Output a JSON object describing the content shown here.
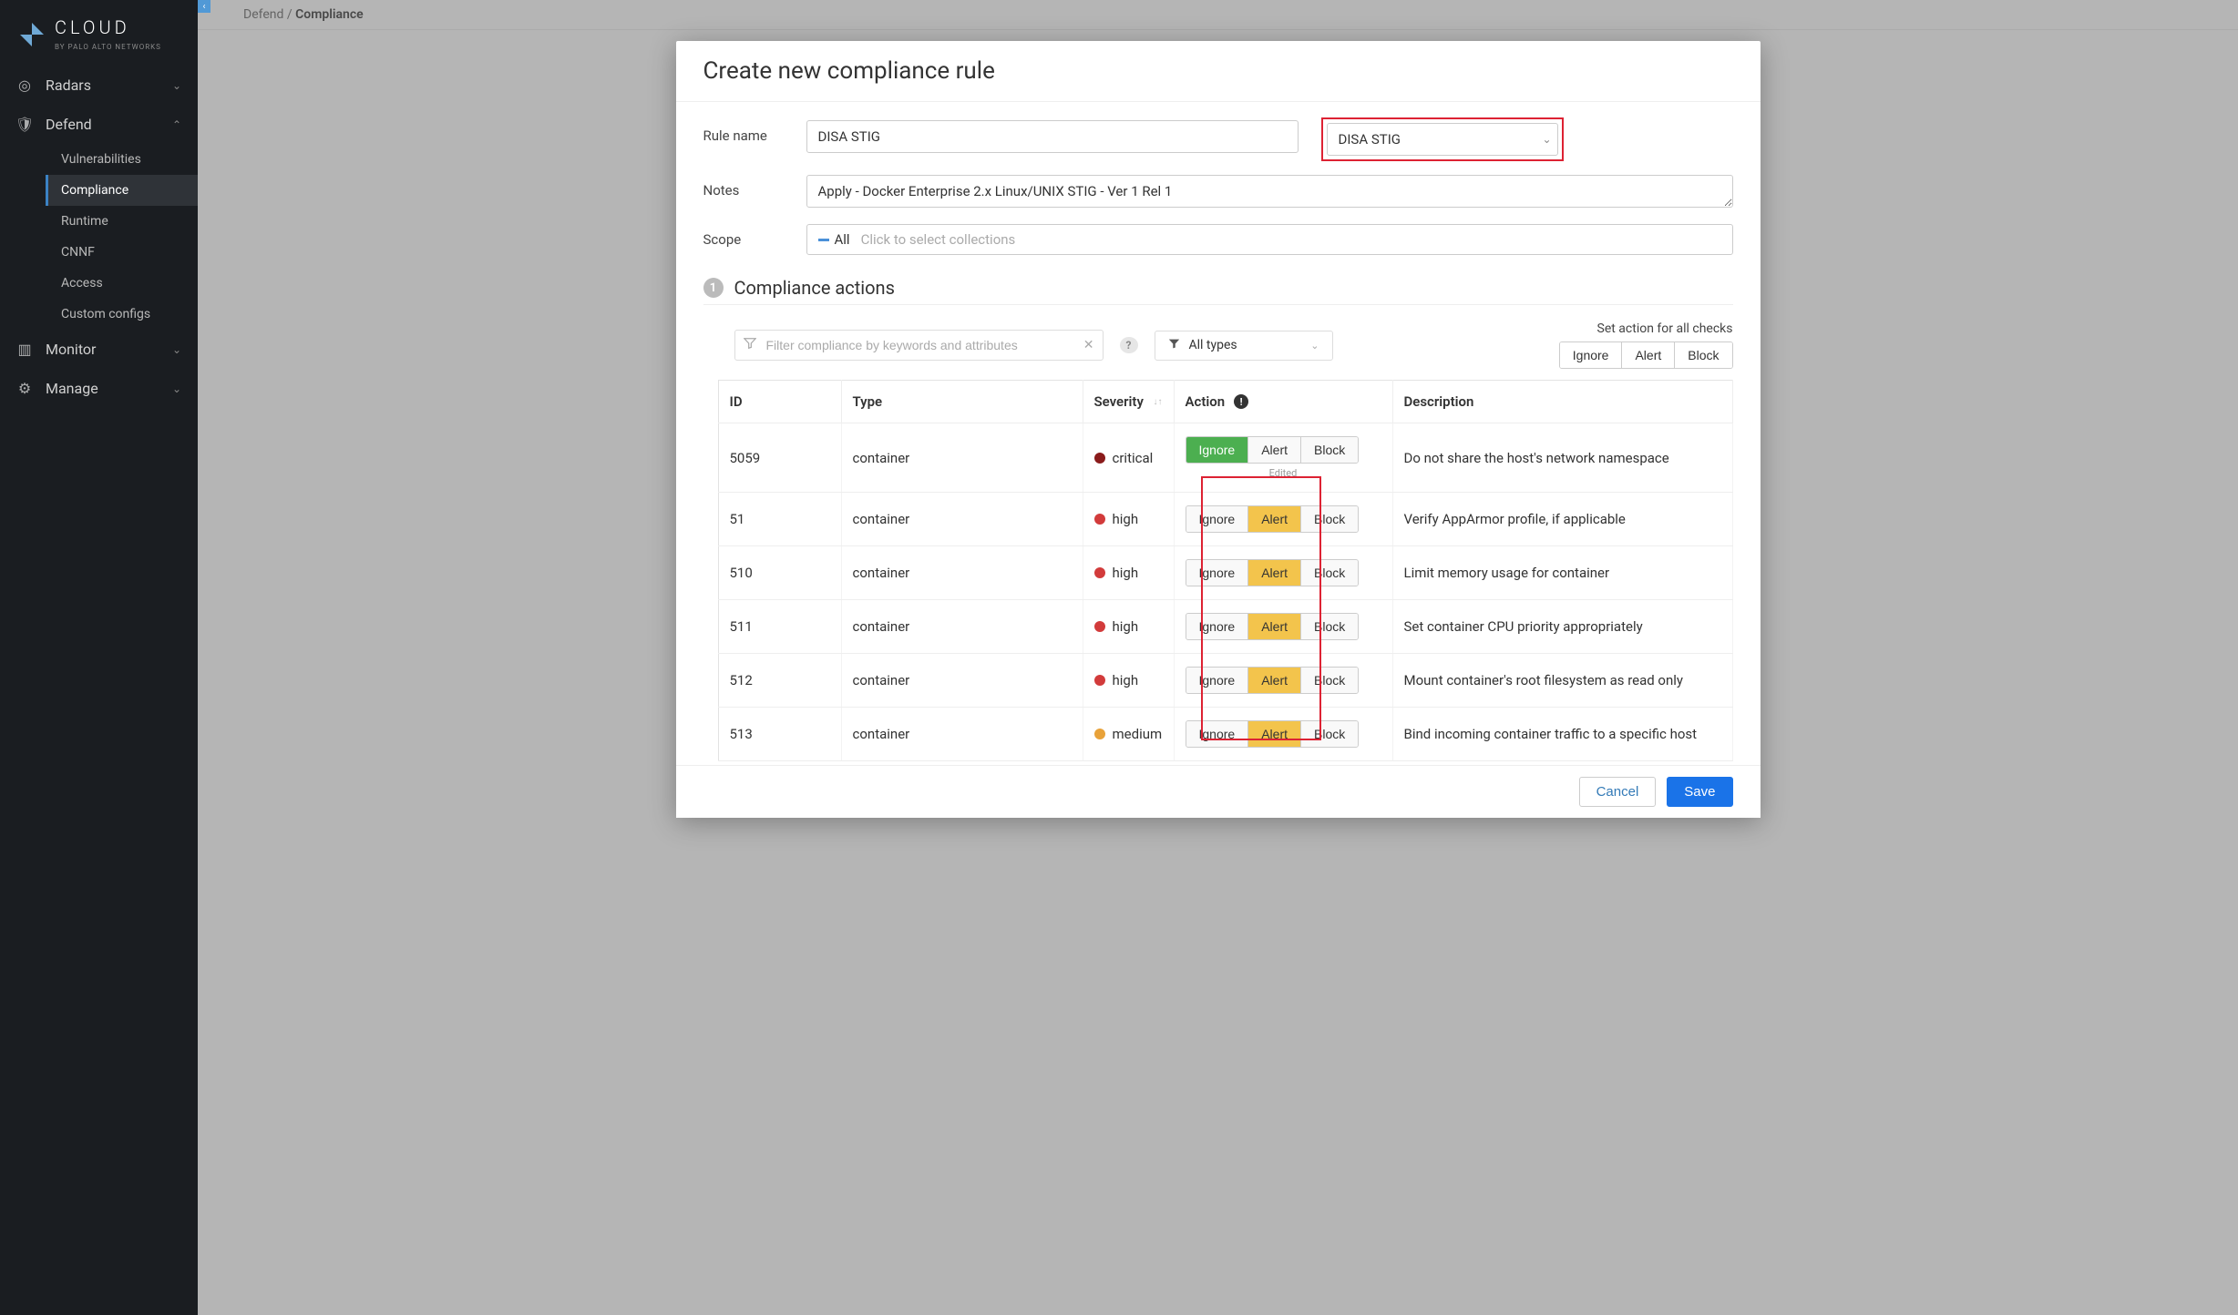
{
  "brand": {
    "name": "CLOUD",
    "byline": "BY PALO ALTO NETWORKS"
  },
  "sidebar": {
    "items": [
      {
        "label": "Radars",
        "icon": "radar",
        "expanded": false
      },
      {
        "label": "Defend",
        "icon": "shield",
        "expanded": true,
        "children": [
          {
            "label": "Vulnerabilities",
            "active": false
          },
          {
            "label": "Compliance",
            "active": true
          },
          {
            "label": "Runtime",
            "active": false
          },
          {
            "label": "CNNF",
            "active": false
          },
          {
            "label": "Access",
            "active": false
          },
          {
            "label": "Custom configs",
            "active": false
          }
        ]
      },
      {
        "label": "Monitor",
        "icon": "monitor",
        "expanded": false
      },
      {
        "label": "Manage",
        "icon": "gear",
        "expanded": false
      }
    ]
  },
  "breadcrumb": {
    "parent": "Defend",
    "sep": "/",
    "current": "Compliance"
  },
  "dialog": {
    "title": "Create new compliance rule",
    "form": {
      "rule_name_label": "Rule name",
      "rule_name_value": "DISA STIG",
      "template_value": "DISA STIG",
      "notes_label": "Notes",
      "notes_value": "Apply - Docker Enterprise 2.x Linux/UNIX STIG - Ver 1 Rel 1",
      "scope_label": "Scope",
      "scope_tag": "All",
      "scope_placeholder": "Click to select collections"
    },
    "section": {
      "step": "1",
      "title": "Compliance actions"
    },
    "filter": {
      "placeholder": "Filter compliance by keywords and attributes",
      "types_label": "All types"
    },
    "bulk": {
      "label": "Set action for all checks",
      "buttons": [
        "Ignore",
        "Alert",
        "Block"
      ]
    },
    "columns": {
      "id": "ID",
      "type": "Type",
      "severity": "Severity",
      "action": "Action",
      "description": "Description"
    },
    "action_buttons": [
      "Ignore",
      "Alert",
      "Block"
    ],
    "edited_text": "Edited",
    "rows": [
      {
        "id": "5059",
        "type": "container",
        "severity": "critical",
        "action": "Ignore",
        "edited": true,
        "description": "Do not share the host's network namespace"
      },
      {
        "id": "51",
        "type": "container",
        "severity": "high",
        "action": "Alert",
        "edited": false,
        "description": "Verify AppArmor profile, if applicable"
      },
      {
        "id": "510",
        "type": "container",
        "severity": "high",
        "action": "Alert",
        "edited": false,
        "description": "Limit memory usage for container"
      },
      {
        "id": "511",
        "type": "container",
        "severity": "high",
        "action": "Alert",
        "edited": false,
        "description": "Set container CPU priority appropriately"
      },
      {
        "id": "512",
        "type": "container",
        "severity": "high",
        "action": "Alert",
        "edited": false,
        "description": "Mount container's root filesystem as read only"
      },
      {
        "id": "513",
        "type": "container",
        "severity": "medium",
        "action": "Alert",
        "edited": false,
        "description": "Bind incoming container traffic to a specific host"
      }
    ],
    "footer": {
      "cancel": "Cancel",
      "save": "Save"
    }
  }
}
